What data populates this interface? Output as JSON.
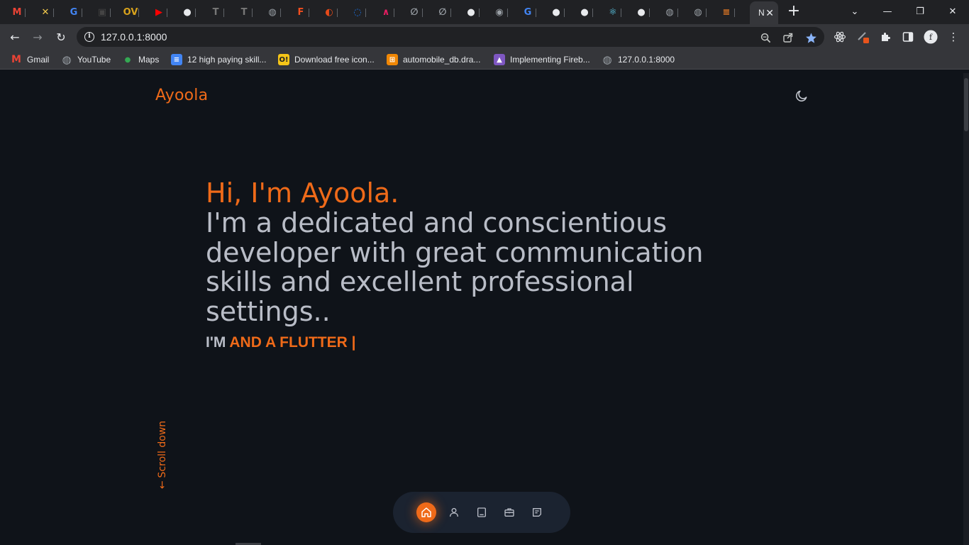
{
  "browser": {
    "tabs": [
      {
        "icon": "gmail-icon",
        "label": "M",
        "color": "#ea4335"
      },
      {
        "icon": "tool-icon",
        "label": "✕",
        "color": "#f2c94c"
      },
      {
        "icon": "google-icon",
        "label": "G",
        "color": "#4285f4"
      },
      {
        "icon": "app-icon",
        "label": "▣",
        "color": "#444"
      },
      {
        "icon": "ov-icon",
        "label": "OV",
        "color": "#d8a21c"
      },
      {
        "icon": "youtube-icon",
        "label": "▶",
        "color": "#ff0000"
      },
      {
        "icon": "github-icon",
        "label": "●",
        "color": "#e8eaed"
      },
      {
        "icon": "t-icon",
        "label": "T",
        "color": "#777"
      },
      {
        "icon": "t-icon",
        "label": "T",
        "color": "#777"
      },
      {
        "icon": "globe-icon",
        "label": "◍",
        "color": "#9aa0a6"
      },
      {
        "icon": "figma-icon",
        "label": "F",
        "color": "#f24e1e"
      },
      {
        "icon": "app-icon",
        "label": "◐",
        "color": "#e64a19"
      },
      {
        "icon": "app-icon",
        "label": "◌",
        "color": "#1a73e8"
      },
      {
        "icon": "app-icon",
        "label": "∧",
        "color": "#e91e63"
      },
      {
        "icon": "app-icon",
        "label": "∅",
        "color": "#9aa0a6"
      },
      {
        "icon": "app-icon",
        "label": "∅",
        "color": "#9aa0a6"
      },
      {
        "icon": "github-icon",
        "label": "●",
        "color": "#e8eaed"
      },
      {
        "icon": "eye-icon",
        "label": "◉",
        "color": "#9aa0a6"
      },
      {
        "icon": "google-icon",
        "label": "G",
        "color": "#4285f4"
      },
      {
        "icon": "github-icon",
        "label": "●",
        "color": "#e8eaed"
      },
      {
        "icon": "github-icon",
        "label": "●",
        "color": "#e8eaed"
      },
      {
        "icon": "react-icon",
        "label": "⚛",
        "color": "#61dafb"
      },
      {
        "icon": "github-icon",
        "label": "●",
        "color": "#e8eaed"
      },
      {
        "icon": "globe-icon",
        "label": "◍",
        "color": "#9aa0a6"
      },
      {
        "icon": "globe-icon",
        "label": "◍",
        "color": "#9aa0a6"
      },
      {
        "icon": "stackoverflow-icon",
        "label": "≡",
        "color": "#f48024"
      }
    ],
    "active_tab_label": "N",
    "url": "127.0.0.1:8000",
    "bookmarks": [
      {
        "label": "Gmail",
        "icon": "gmail-icon",
        "glyph": "M",
        "color": "#ea4335"
      },
      {
        "label": "YouTube",
        "icon": "globe-icon",
        "glyph": "◍",
        "color": "#9aa0a6"
      },
      {
        "label": "Maps",
        "icon": "maps-icon",
        "glyph": "●",
        "color": "#34a853"
      },
      {
        "label": "12 high paying skill...",
        "icon": "docs-icon",
        "glyph": "≡",
        "color": "#4285f4"
      },
      {
        "label": "Download free icon...",
        "icon": "icon-site-icon",
        "glyph": "O!",
        "color": "#f5c518"
      },
      {
        "label": "automobile_db.dra...",
        "icon": "drawio-icon",
        "glyph": "⊞",
        "color": "#f08705"
      },
      {
        "label": "Implementing Fireb...",
        "icon": "firebase-icon",
        "glyph": "▲",
        "color": "#7e57c2"
      },
      {
        "label": "127.0.0.1:8000",
        "icon": "globe-icon",
        "glyph": "◍",
        "color": "#9aa0a6"
      }
    ]
  },
  "site": {
    "logo": "Ayoola",
    "hero": {
      "hello": "Hi, I'm Ayoola.",
      "description": "I'm a dedicated and conscientious developer with great communication skills and excellent professional settings..",
      "role_prefix": "I'M ",
      "role_typed": "AND A FLUTTER |"
    },
    "scroll_down_label": "Scroll down",
    "nav": [
      {
        "name": "home",
        "active": true
      },
      {
        "name": "about",
        "active": false
      },
      {
        "name": "resume",
        "active": false
      },
      {
        "name": "portfolio",
        "active": false
      },
      {
        "name": "contact",
        "active": false
      }
    ],
    "colors": {
      "accent": "#ef6a19",
      "background": "#0f1319",
      "text": "#b9bdc7",
      "nav_bg": "#1b2330"
    }
  }
}
